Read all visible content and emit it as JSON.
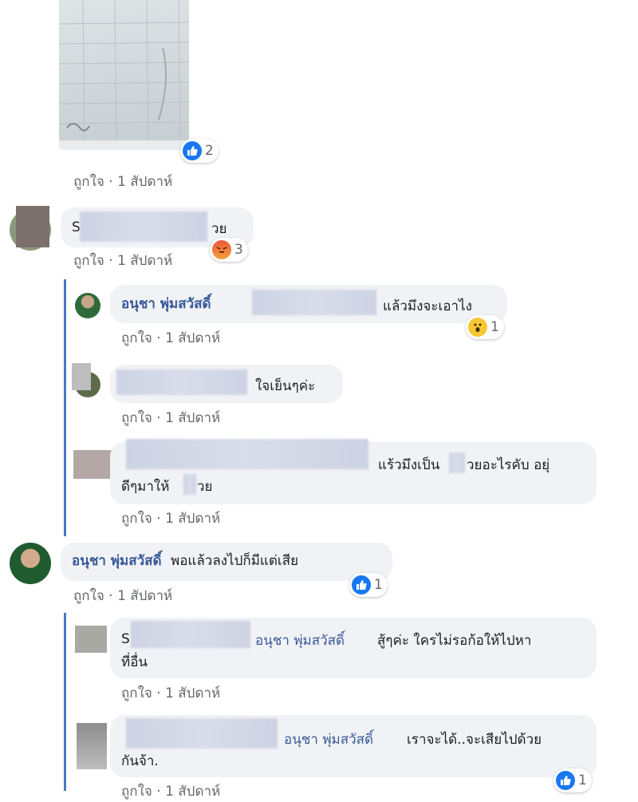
{
  "image_post": {
    "reaction": {
      "icon": "like-icon",
      "count": "2"
    },
    "meta": {
      "like": "ถูกใจ",
      "time": "1 สัปดาห์"
    }
  },
  "comments": [
    {
      "id": "c1",
      "text_prefix": "S",
      "text_suffix": "วย",
      "reaction": {
        "icon": "angry-icon",
        "count": "3"
      },
      "meta": {
        "like": "ถูกใจ",
        "time": "1 สัปดาห์"
      }
    },
    {
      "id": "r1",
      "author": "อนุชา พุ่มสวัสดิ์",
      "text": "แล้วมึงจะเอาไง",
      "reaction": {
        "icon": "wow-icon",
        "count": "1"
      },
      "meta": {
        "like": "ถูกใจ",
        "time": "1 สัปดาห์"
      }
    },
    {
      "id": "r2",
      "text": "ใจเย็นๆค่ะ",
      "meta": {
        "like": "ถูกใจ",
        "time": "1 สัปดาห์"
      }
    },
    {
      "id": "r3",
      "text_line1": "แร้วมึงเป็น",
      "text_line1b": "วยอะไรคับ อยุ่",
      "text_line2": "ดีๆมาให้",
      "text_line2b": "วย",
      "meta": {
        "like": "ถูกใจ",
        "time": "1 สัปดาห์"
      }
    },
    {
      "id": "c2",
      "author": "อนุชา พุ่มสวัสดิ์",
      "text": "พอแล้วลงไปก็มีแต่เสีย",
      "reaction": {
        "icon": "like-icon",
        "count": "1"
      },
      "meta": {
        "like": "ถูกใจ",
        "time": "1 สัปดาห์"
      }
    },
    {
      "id": "r4",
      "text_prefix": "S",
      "mention": "อนุชา พุ่มสวัสดิ์",
      "text_line1": "สู้ๆค่ะ ใครไม่รอก้อให้ไปหา",
      "text_line2": "ที่อื่น",
      "meta": {
        "like": "ถูกใจ",
        "time": "1 สัปดาห์"
      }
    },
    {
      "id": "r5",
      "mention": "อนุชา พุ่มสวัสดิ์",
      "text_line1": "เราจะได้..จะเสียไปด้วย",
      "text_line2": "กันจ้า.",
      "reaction": {
        "icon": "like-icon",
        "count": "1"
      },
      "meta": {
        "like": "ถูกใจ",
        "time": "1 สัปดาห์"
      }
    }
  ],
  "colors": {
    "link": "#385898",
    "bubble": "#f0f2f5",
    "thread_line": "#4a78c8",
    "like_blue": "#1877f2",
    "meta_gray": "#65676b"
  }
}
